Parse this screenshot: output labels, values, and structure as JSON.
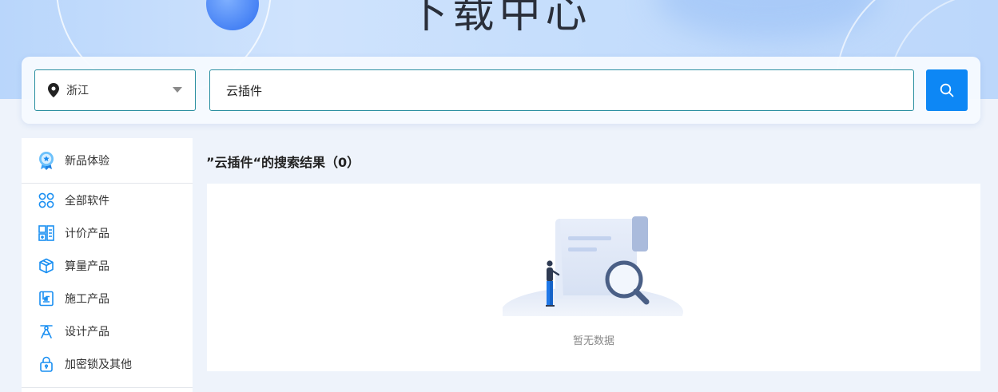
{
  "hero": {
    "title": "下载中心"
  },
  "search": {
    "region": "浙江",
    "query": "云插件",
    "button_icon": "search-icon"
  },
  "sidebar": {
    "top": {
      "label": "新品体验",
      "icon": "badge-icon"
    },
    "items": [
      {
        "label": "全部软件",
        "icon": "apps-grid-icon"
      },
      {
        "label": "计价产品",
        "icon": "calculator-icon"
      },
      {
        "label": "算量产品",
        "icon": "cube-icon"
      },
      {
        "label": "施工产品",
        "icon": "blueprint-icon"
      },
      {
        "label": "设计产品",
        "icon": "compass-icon"
      },
      {
        "label": "加密锁及其他",
        "icon": "lock-icon"
      }
    ]
  },
  "results": {
    "title": "”云插件“的搜索结果（0）",
    "empty_text": "暂无数据"
  },
  "colors": {
    "accent": "#0d87f5",
    "icon_blue": "#1a8ff2",
    "input_border": "#2a8fa0"
  }
}
